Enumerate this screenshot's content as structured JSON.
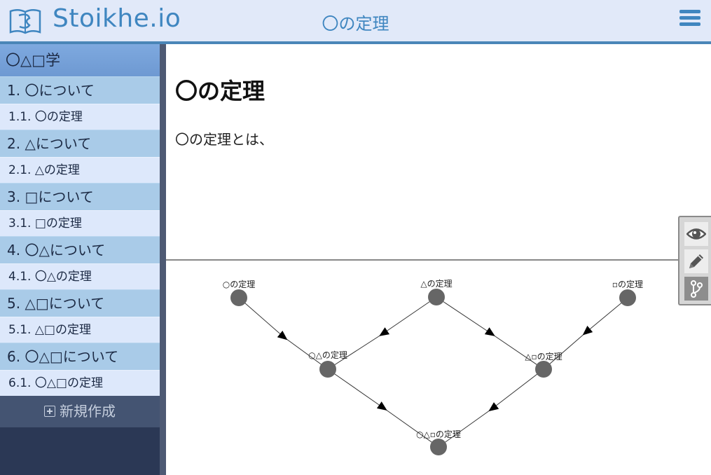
{
  "header": {
    "logo_text": "Stoikhe.io",
    "page_title": "〇の定理",
    "menu_icon": "hamburger-menu-icon"
  },
  "sidebar": {
    "heading": "〇△□学",
    "chapters": [
      {
        "label": "1. 〇について",
        "section": "1.1. 〇の定理"
      },
      {
        "label": "2. △について",
        "section": "2.1. △の定理"
      },
      {
        "label": "3. □について",
        "section": "3.1. □の定理"
      },
      {
        "label": "4. 〇△について",
        "section": "4.1. 〇△の定理"
      },
      {
        "label": "5. △□について",
        "section": "5.1. △□の定理"
      },
      {
        "label": "6. 〇△□について",
        "section": "6.1. 〇△□の定理"
      }
    ],
    "new_button": "新規作成"
  },
  "document": {
    "title": "〇の定理",
    "body": "〇の定理とは、"
  },
  "graph": {
    "nodes": [
      {
        "label": "○の定理"
      },
      {
        "label": "△の定理"
      },
      {
        "label": "▫の定理"
      },
      {
        "label": "○△の定理"
      },
      {
        "label": "△▫の定理"
      },
      {
        "label": "○△▫の定理"
      }
    ],
    "node_color": "#666666"
  },
  "tools": {
    "view": "eye-icon",
    "edit": "pencil-icon",
    "branch": "git-branch-icon"
  },
  "colors": {
    "accent": "#3f86c0",
    "header_bg": "#e1e9f9",
    "sidebar_bg": "#2b3855",
    "chapter_bg": "#a9cbe8",
    "section_bg": "#dde8fb"
  }
}
